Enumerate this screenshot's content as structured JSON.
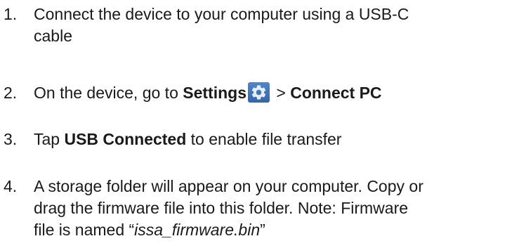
{
  "steps": [
    {
      "number": "1.",
      "line1": "Connect the device to your computer using a USB-C",
      "line2": "cable"
    },
    {
      "number": "2.",
      "prefix": "On the device, go to ",
      "settings_label": "Settings",
      "settings_icon": "gear-icon",
      "separator": " > ",
      "connect_label": "Connect PC"
    },
    {
      "number": "3.",
      "prefix": "Tap ",
      "usb_label": "USB Connected",
      "suffix": " to enable file transfer"
    },
    {
      "number": "4.",
      "line1": "A storage folder will appear on your computer. Copy or",
      "line2": "drag the firmware file into this folder.  Note: Firmware",
      "line3_prefix": "file is named “",
      "filename": "issa_firmware.bin",
      "line3_suffix": "”"
    }
  ],
  "colors": {
    "text": "#1a1a1a",
    "gear_icon_bg": "#3f76bd"
  }
}
